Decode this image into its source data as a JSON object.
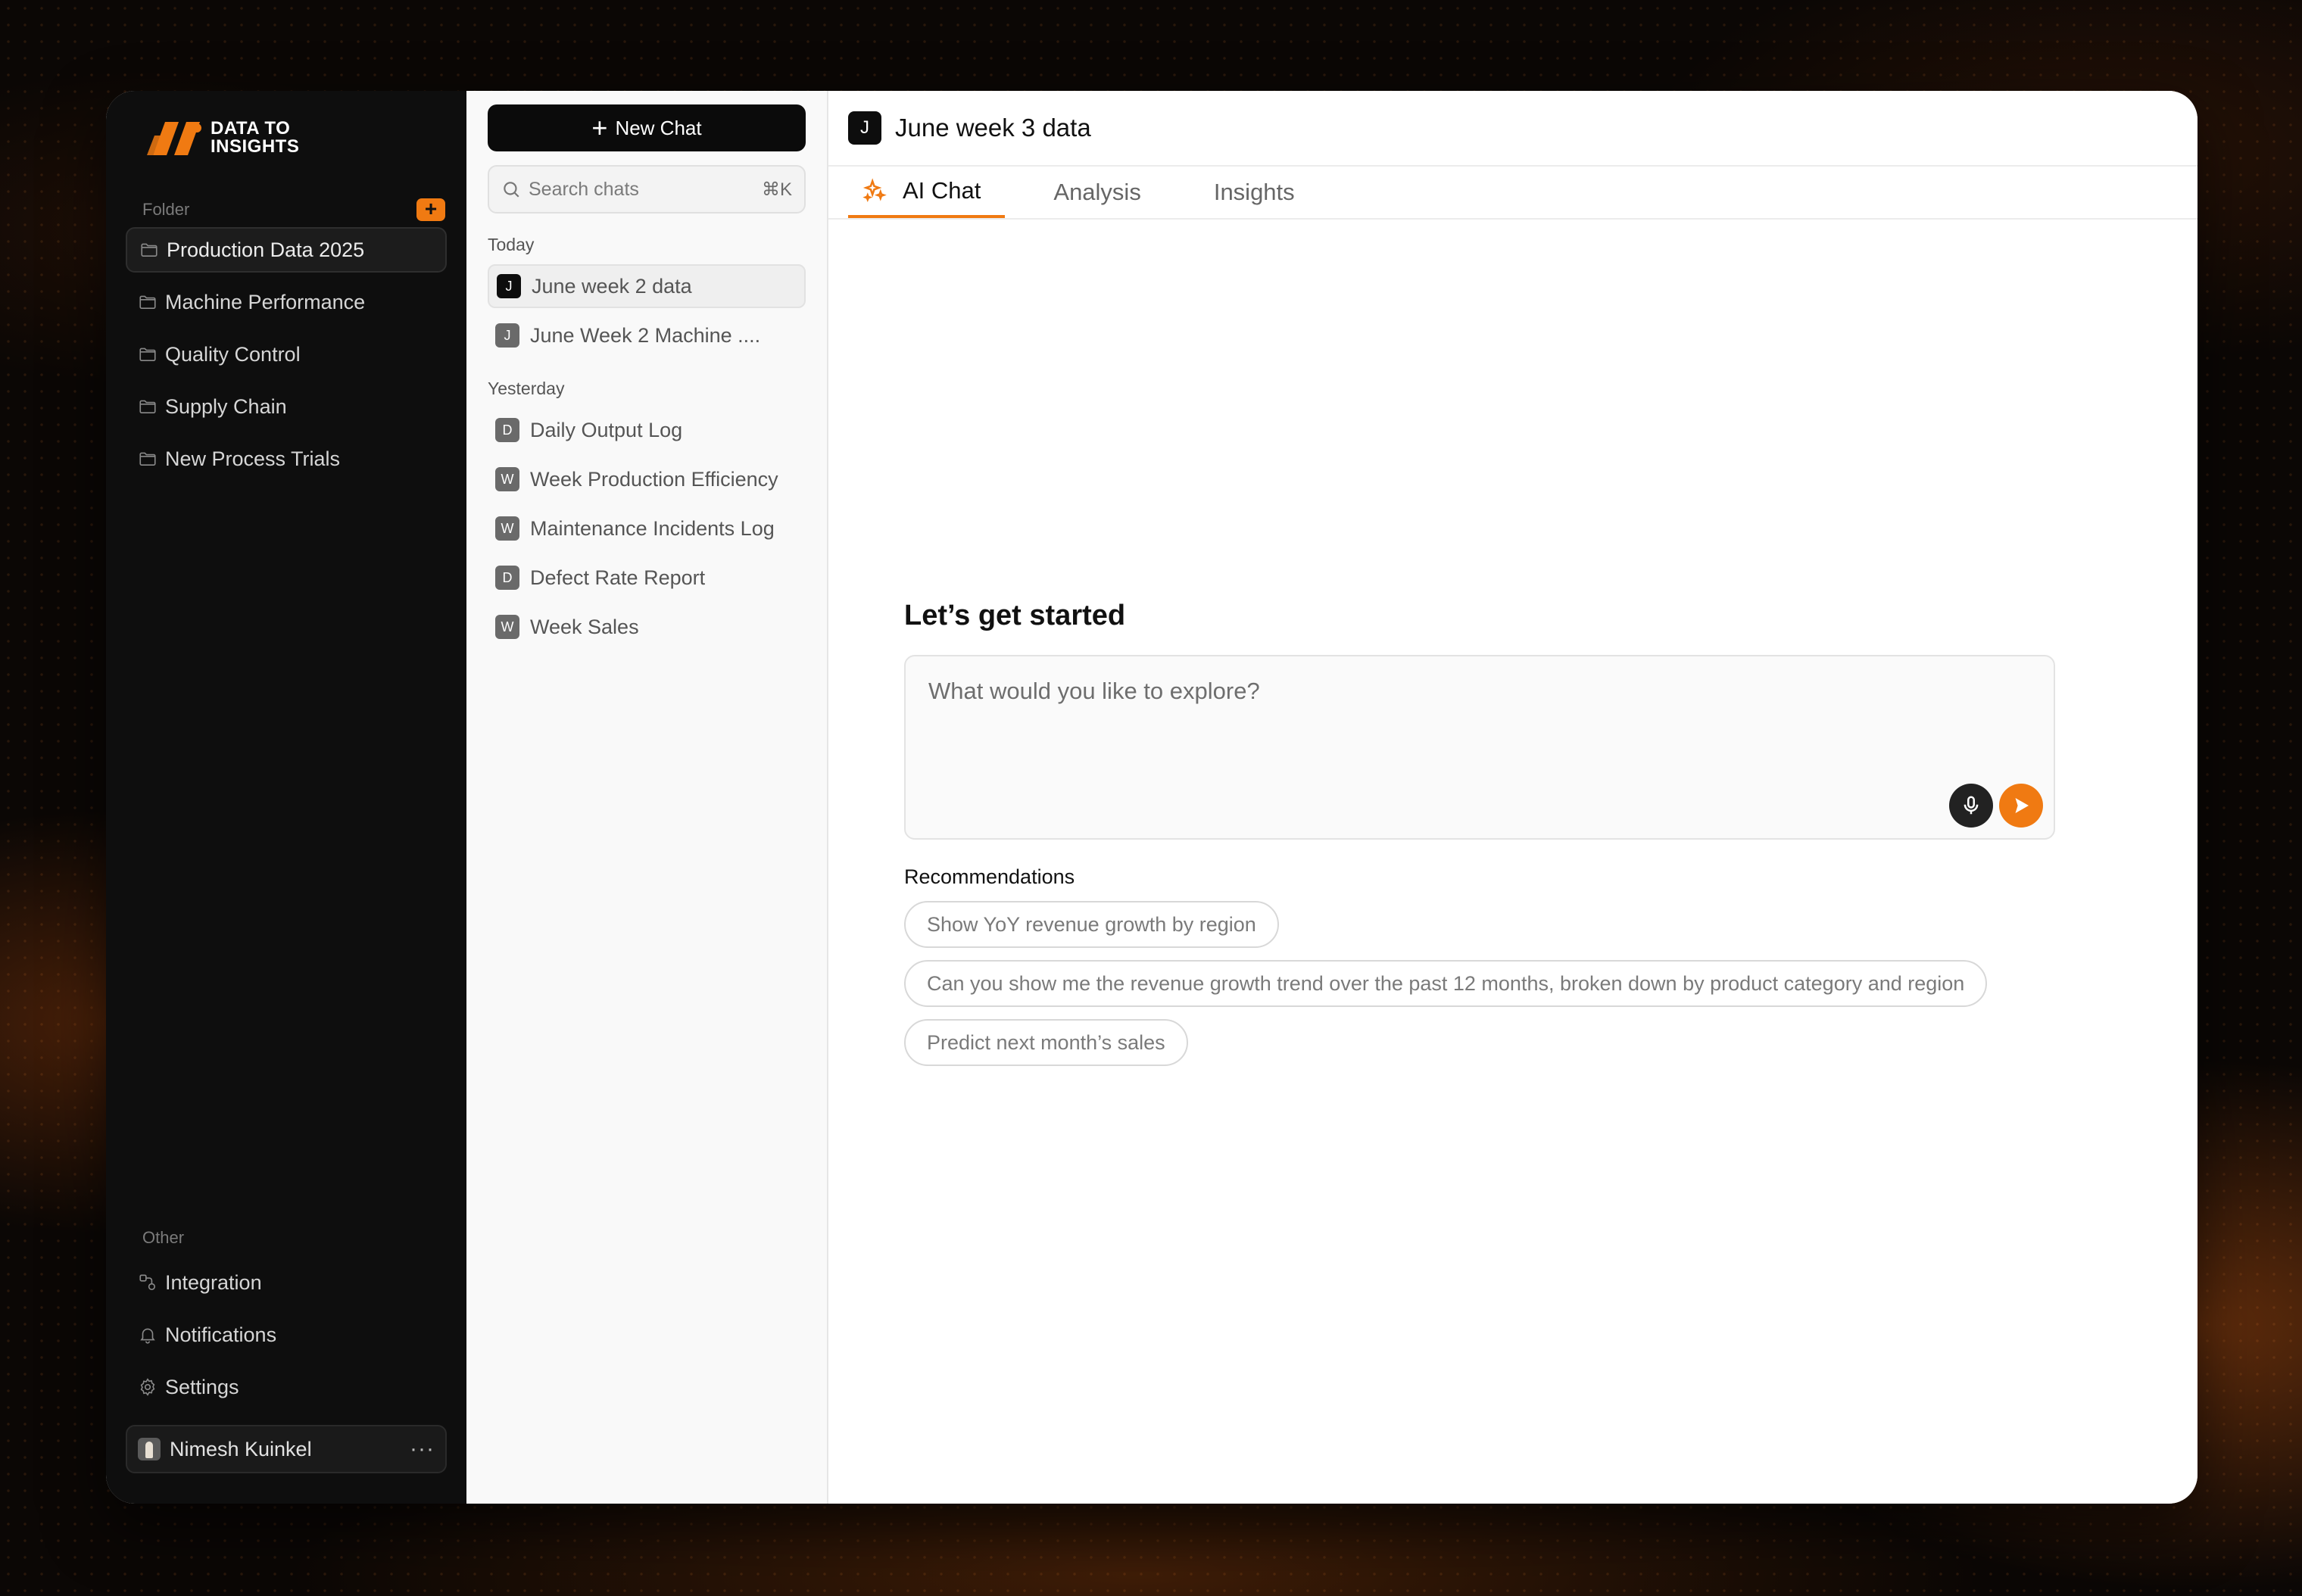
{
  "brand": {
    "line1": "DATA TO",
    "line2": "INSIGHTS",
    "accent": "#f07a12"
  },
  "sidebar": {
    "folder_label": "Folder",
    "add_label": "+",
    "folders": [
      {
        "label": "Production Data 2025",
        "active": true
      },
      {
        "label": "Machine Performance"
      },
      {
        "label": "Quality Control"
      },
      {
        "label": "Supply Chain"
      },
      {
        "label": "New Process Trials"
      }
    ],
    "other_label": "Other",
    "other_items": [
      {
        "label": "Integration",
        "icon": "integration-icon"
      },
      {
        "label": "Notifications",
        "icon": "bell-icon"
      },
      {
        "label": "Settings",
        "icon": "gear-icon"
      }
    ],
    "user": {
      "name": "Nimesh Kuinkel",
      "more": "···"
    }
  },
  "chatlist": {
    "new_chat_label": "New Chat",
    "search_placeholder": "Search chats",
    "search_shortcut": "⌘K",
    "today_label": "Today",
    "today": [
      {
        "initial": "J",
        "label": "June week 2 data",
        "active": true
      },
      {
        "initial": "J",
        "label": "June Week 2 Machine ...."
      }
    ],
    "yesterday_label": "Yesterday",
    "yesterday": [
      {
        "initial": "D",
        "label": "Daily Output Log"
      },
      {
        "initial": "W",
        "label": "Week Production Efficiency"
      },
      {
        "initial": "W",
        "label": "Maintenance Incidents Log"
      },
      {
        "initial": "D",
        "label": "Defect Rate Report"
      },
      {
        "initial": "W",
        "label": "Week Sales"
      }
    ]
  },
  "main": {
    "initial": "J",
    "title": "June week 3 data",
    "tabs": [
      {
        "label": "AI Chat",
        "active": true
      },
      {
        "label": "Analysis"
      },
      {
        "label": "Insights"
      }
    ],
    "start_title": "Let’s get started",
    "prompt_placeholder": "What would you like to explore?",
    "recommendations_label": "Recommendations",
    "recommendations": [
      "Show YoY revenue growth by region",
      "Can you show me the revenue growth trend over the past 12 months, broken down by product category and region",
      "Predict next month’s sales"
    ]
  }
}
